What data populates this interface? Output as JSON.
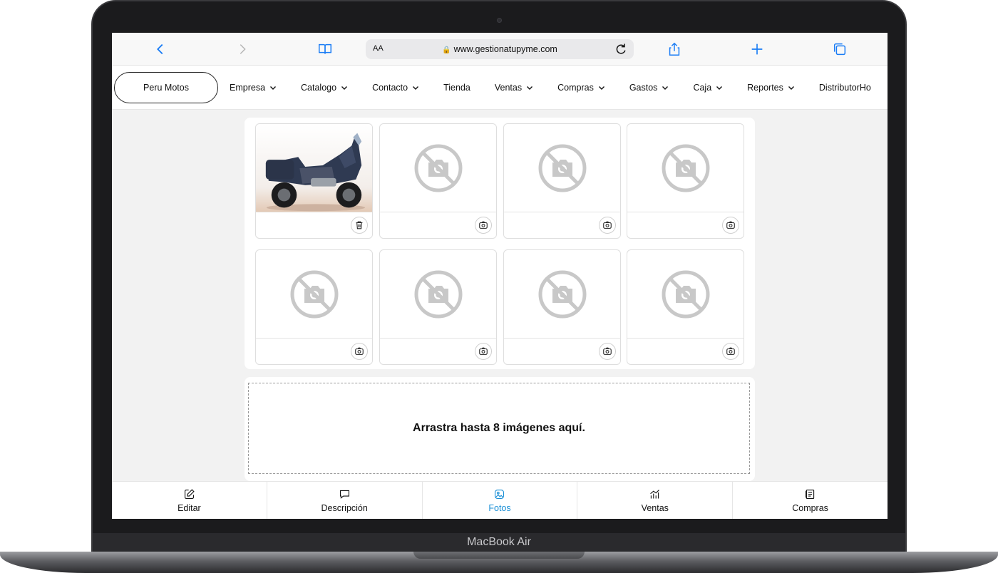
{
  "device": {
    "brand": "MacBook Air"
  },
  "browser": {
    "text_size_label": "AA",
    "url": "www.gestionatupyme.com"
  },
  "nav": {
    "company": "Peru Motos",
    "items": [
      {
        "label": "Empresa",
        "has_dropdown": true
      },
      {
        "label": "Catalogo",
        "has_dropdown": true
      },
      {
        "label": "Contacto",
        "has_dropdown": true
      },
      {
        "label": "Tienda",
        "has_dropdown": false
      },
      {
        "label": "Ventas",
        "has_dropdown": true
      },
      {
        "label": "Compras",
        "has_dropdown": true
      },
      {
        "label": "Gastos",
        "has_dropdown": true
      },
      {
        "label": "Caja",
        "has_dropdown": true
      },
      {
        "label": "Reportes",
        "has_dropdown": true
      },
      {
        "label": "DistributorHo",
        "has_dropdown": false
      }
    ]
  },
  "gallery": {
    "slots": [
      {
        "has_image": true,
        "action": "trash-icon"
      },
      {
        "has_image": false,
        "action": "camera-icon"
      },
      {
        "has_image": false,
        "action": "camera-icon"
      },
      {
        "has_image": false,
        "action": "camera-icon"
      },
      {
        "has_image": false,
        "action": "camera-icon"
      },
      {
        "has_image": false,
        "action": "camera-icon"
      },
      {
        "has_image": false,
        "action": "camera-icon"
      },
      {
        "has_image": false,
        "action": "camera-icon"
      }
    ]
  },
  "dropzone": {
    "text": "Arrastra hasta 8 imágenes aquí."
  },
  "tabs": [
    {
      "label": "Editar",
      "icon": "edit-icon",
      "active": false
    },
    {
      "label": "Descripción",
      "icon": "comment-icon",
      "active": false
    },
    {
      "label": "Fotos",
      "icon": "image-icon",
      "active": true
    },
    {
      "label": "Ventas",
      "icon": "chart-icon",
      "active": false
    },
    {
      "label": "Compras",
      "icon": "invoice-icon",
      "active": false
    }
  ],
  "colors": {
    "accent": "#1a8fd6",
    "safari_blue": "#1a7cf5"
  }
}
